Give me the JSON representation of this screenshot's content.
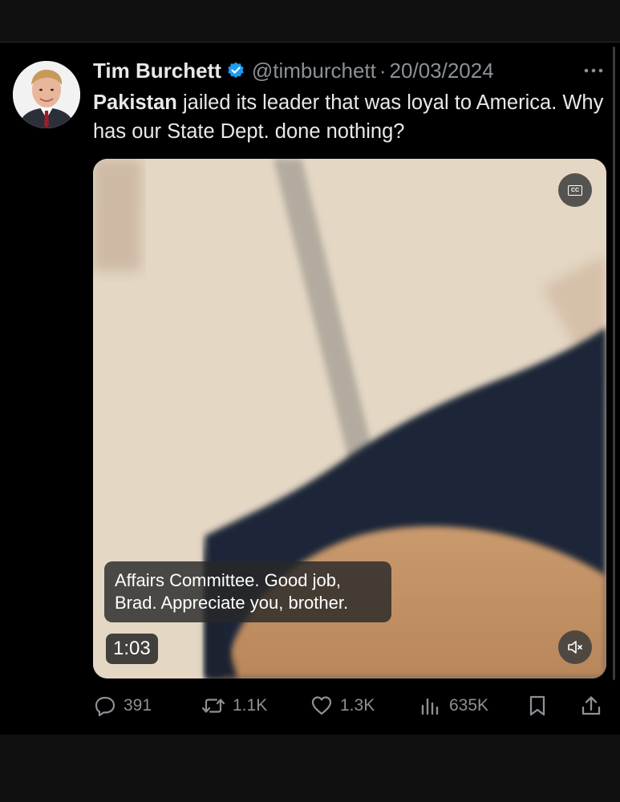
{
  "tweet": {
    "author_name": "Tim Burchett",
    "handle": "@timburchett",
    "separator": "·",
    "date": "20/03/2024",
    "text_bold": "Pakistan",
    "text_rest": " jailed its leader that was loyal to America. Why has our State Dept. done nothing?"
  },
  "video": {
    "caption_line1": "Affairs Committee. Good job,",
    "caption_line2": "Brad. Appreciate you, brother.",
    "time": "1:03",
    "cc_label": "CC"
  },
  "actions": {
    "replies": "391",
    "reposts": "1.1K",
    "likes": "1.3K",
    "views": "635K"
  },
  "icons": [
    "verified-badge-icon",
    "more-icon",
    "cc-icon",
    "mute-icon",
    "reply-icon",
    "repost-icon",
    "like-icon",
    "views-icon",
    "bookmark-icon",
    "share-icon"
  ],
  "colors": {
    "background": "#000000",
    "text": "#e7e9ea",
    "muted": "#8b9196",
    "verified": "#1d9bf0"
  }
}
